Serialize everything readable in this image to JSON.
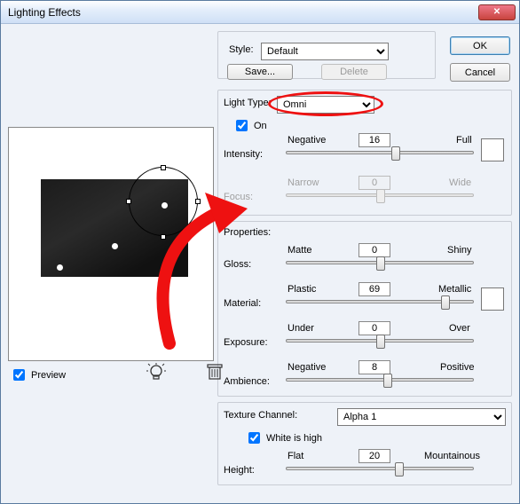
{
  "window": {
    "title": "Lighting Effects"
  },
  "buttons": {
    "ok": "OK",
    "cancel": "Cancel",
    "save": "Save...",
    "delete": "Delete"
  },
  "style": {
    "label": "Style:",
    "value": "Default"
  },
  "light": {
    "type_label": "Light Type:",
    "type_value": "Omni",
    "on_label": "On",
    "intensity_label": "Intensity:",
    "intensity_left": "Negative",
    "intensity_right": "Full",
    "intensity_value": "16",
    "focus_label": "Focus:",
    "focus_left": "Narrow",
    "focus_right": "Wide",
    "focus_value": "0"
  },
  "props": {
    "header": "Properties:",
    "gloss_label": "Gloss:",
    "gloss_left": "Matte",
    "gloss_right": "Shiny",
    "gloss_value": "0",
    "material_label": "Material:",
    "material_left": "Plastic",
    "material_right": "Metallic",
    "material_value": "69",
    "exposure_label": "Exposure:",
    "exposure_left": "Under",
    "exposure_right": "Over",
    "exposure_value": "0",
    "ambience_label": "Ambience:",
    "ambience_left": "Negative",
    "ambience_right": "Positive",
    "ambience_value": "8"
  },
  "texture": {
    "channel_label": "Texture Channel:",
    "channel_value": "Alpha 1",
    "white_label": "White is high",
    "height_label": "Height:",
    "height_left": "Flat",
    "height_right": "Mountainous",
    "height_value": "20"
  },
  "preview": {
    "label": "Preview"
  }
}
